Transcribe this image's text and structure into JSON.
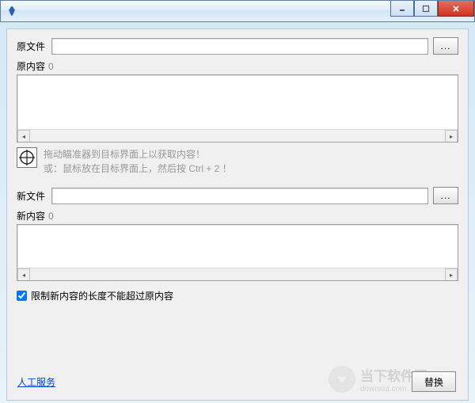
{
  "window": {
    "title": ""
  },
  "source": {
    "file_label": "原文件",
    "file_value": "",
    "browse_label": "...",
    "content_label": "原内容",
    "content_count": "0",
    "content_value": ""
  },
  "hint": {
    "line1": "拖动瞄准器到目标界面上以获取内容！",
    "line2": "或：鼠标放在目标界面上，然后按 Ctrl + 2 ！"
  },
  "target": {
    "file_label": "新文件",
    "file_value": "",
    "browse_label": "...",
    "content_label": "新内容",
    "content_count": "0",
    "content_value": ""
  },
  "checkbox": {
    "label": "限制新内容的长度不能超过原内容",
    "checked": true
  },
  "footer": {
    "link_label": "人工服务"
  },
  "actions": {
    "replace_label": "替换"
  },
  "watermark": {
    "main": "当下软件园",
    "sub": "downxia.com"
  }
}
